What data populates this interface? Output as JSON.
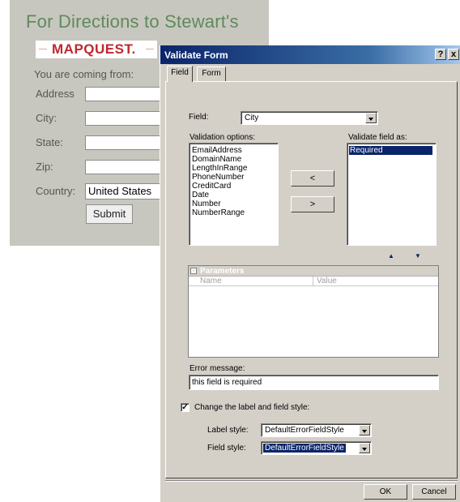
{
  "background_form": {
    "heading": "For Directions to Stewart's",
    "logo_text": "MAPQUEST.",
    "coming_from": "You are coming from:",
    "fields": [
      {
        "label": "Address",
        "value": ""
      },
      {
        "label": "City:",
        "value": ""
      },
      {
        "label": "State:",
        "value": ""
      },
      {
        "label": "Zip:",
        "value": ""
      },
      {
        "label": "Country:",
        "value": "United States"
      }
    ],
    "submit_label": "Submit",
    "colors": {
      "panel": "#c7c7bf",
      "heading": "#5f8a5a",
      "logo": "#c0272d"
    }
  },
  "dialog": {
    "title": "Validate Form",
    "help_label": "?",
    "close_label": "x",
    "tabs": [
      {
        "label": "Field"
      },
      {
        "label": "Form"
      }
    ],
    "field_label": "Field:",
    "field_value": "City",
    "validation_options_label": "Validation options:",
    "validation_options": [
      "EmailAddress",
      "DomainName",
      "LengthInRange",
      "PhoneNumber",
      "CreditCard",
      "Date",
      "Number",
      "NumberRange"
    ],
    "validate_as_label": "Validate field as:",
    "validate_as": [
      "Required"
    ],
    "move_left_label": "<",
    "move_right_label": ">",
    "up_icon": "▲",
    "down_icon": "▼",
    "parameters": {
      "header": "Parameters",
      "collapse_icon": "-",
      "columns": [
        "Name",
        "Value"
      ]
    },
    "error_message_label": "Error message:",
    "error_message_value": "this field is required",
    "change_style_label": "Change the label and field style:",
    "change_style_checked": "✓",
    "label_style_label": "Label style:",
    "label_style_value": "DefaultErrorFieldStyle",
    "field_style_label": "Field style:",
    "field_style_value": "DefaultErrorFieldStyle",
    "ok_label": "OK",
    "cancel_label": "Cancel",
    "colors": {
      "titlebar": "#0a246a",
      "face": "#d4d0c8",
      "selection": "#0a246a"
    }
  }
}
